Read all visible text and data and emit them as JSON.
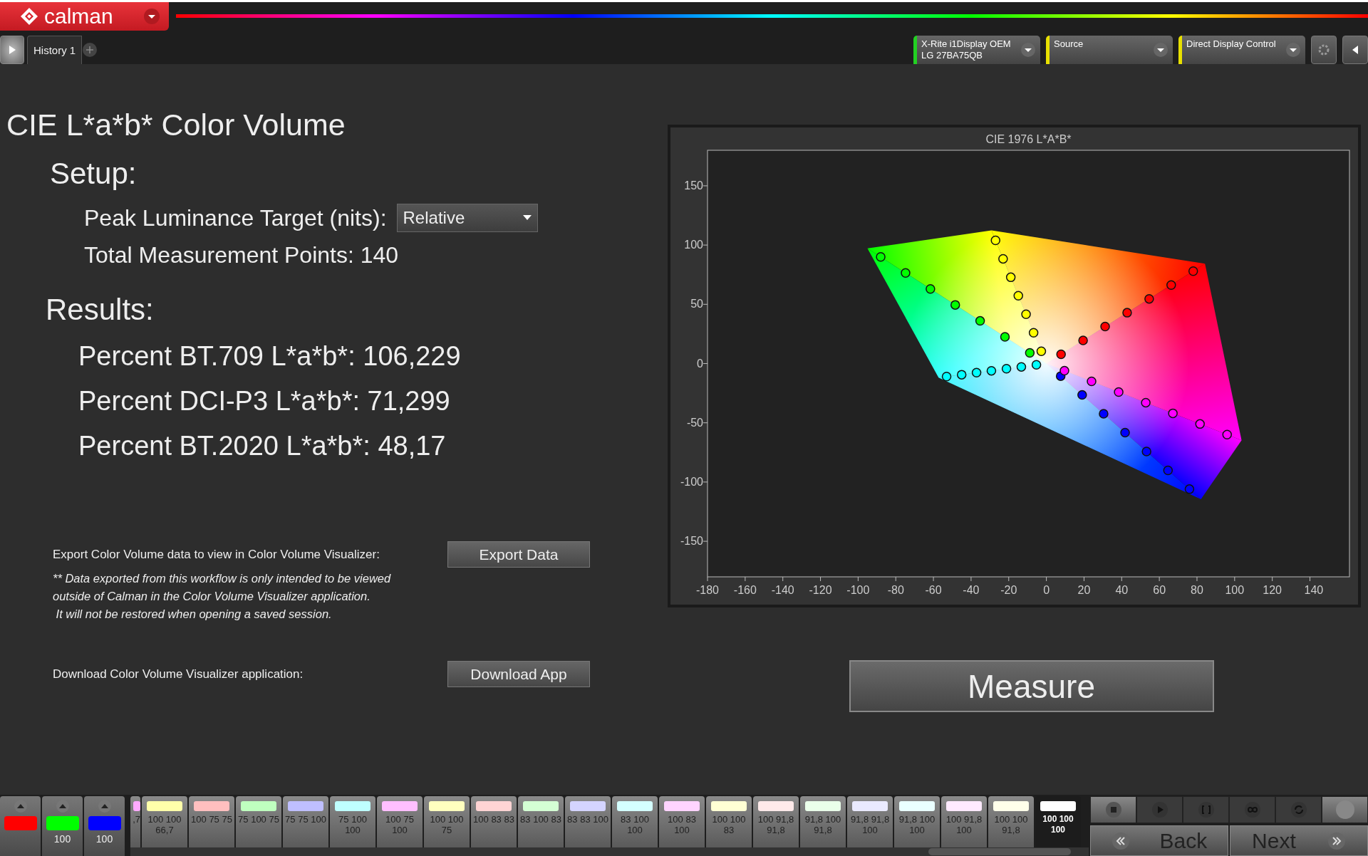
{
  "app": {
    "logo": "calman"
  },
  "tabs": [
    {
      "label": "History 1",
      "selected": true
    }
  ],
  "devices": [
    {
      "lines": [
        "X-Rite i1Display OEM",
        "LG 27BA75QB"
      ],
      "color": "#22d022"
    },
    {
      "lines": [
        "Source"
      ],
      "color": "#e8e000"
    },
    {
      "lines": [
        "Direct Display Control"
      ],
      "color": "#e8e000"
    }
  ],
  "page": {
    "title": "CIE L*a*b* Color Volume",
    "setup_heading": "Setup:",
    "peak_label": "Peak Luminance Target (nits):",
    "peak_value": "Relative",
    "total": "Total Measurement Points: 140",
    "results_heading": "Results:",
    "results": [
      "Percent BT.709 L*a*b*: 106,229",
      "Percent DCI-P3 L*a*b*: 71,299",
      "Percent BT.2020 L*a*b*: 48,17"
    ],
    "export_label": "Export Color Volume data to view in Color Volume Visualizer:",
    "export_button": "Export Data",
    "note_lines": [
      "** Data exported from this workflow is only intended to be viewed",
      "outside of Calman in the Color Volume Visualizer application.",
      " It will not be restored when opening a saved session."
    ],
    "download_label": "Download Color Volume Visualizer application:",
    "download_button": "Download App"
  },
  "chart": {
    "chart_data": {
      "type": "scatter",
      "title": "CIE 1976 L*A*B*",
      "xlim": [
        -180,
        161
      ],
      "ylim": [
        -180,
        180
      ],
      "xticks": [
        -180,
        -160,
        -140,
        -120,
        -100,
        -80,
        -60,
        -40,
        -20,
        0,
        20,
        40,
        60,
        80,
        100,
        120,
        140
      ],
      "yticks": [
        -150,
        -100,
        -50,
        0,
        50,
        100,
        150
      ],
      "series": [
        {
          "color": "#ff0000",
          "x": [
            7.8,
            19.5,
            31.2,
            42.9,
            54.6,
            66.3,
            78
          ],
          "values": [
            7.8,
            19.5,
            31.2,
            42.9,
            54.6,
            66.3,
            78
          ]
        },
        {
          "color": "#ffff00",
          "x": [
            -2.7,
            -6.8,
            -10.8,
            -14.9,
            -18.9,
            -23,
            -27
          ],
          "values": [
            10.4,
            26,
            41.6,
            57.2,
            72.8,
            88.4,
            104
          ]
        },
        {
          "color": "#00ff00",
          "x": [
            -8.8,
            -22,
            -35.2,
            -48.4,
            -61.6,
            -74.8,
            -88
          ],
          "values": [
            9,
            22.5,
            36,
            49.5,
            63,
            76.5,
            90
          ]
        },
        {
          "color": "#00ffff",
          "x": [
            -5.3,
            -13.3,
            -21.2,
            -29.2,
            -37.1,
            -45,
            -53
          ],
          "values": [
            -1.1,
            -2.8,
            -4.4,
            -6.1,
            -7.7,
            -9.4,
            -11
          ]
        },
        {
          "color": "#0000ff",
          "x": [
            7.6,
            19,
            30.4,
            41.8,
            53.2,
            64.6,
            76
          ],
          "values": [
            -10.6,
            -26.5,
            -42.4,
            -58.3,
            -74.2,
            -90.1,
            -106
          ]
        },
        {
          "color": "#ff00ff",
          "x": [
            9.6,
            24,
            38.4,
            52.8,
            67.2,
            81.6,
            96
          ],
          "values": [
            -6,
            -15,
            -24,
            -33,
            -42,
            -51,
            -60
          ]
        }
      ]
    }
  },
  "measure_button": "Measure",
  "channels": [
    {
      "color": "#ff0000"
    },
    {
      "color": "#00ff00",
      "label": "100"
    },
    {
      "color": "#0000ff",
      "label": "100"
    }
  ],
  "swatches": [
    {
      "color": "#ffaaff",
      "label": ",7",
      "selected": false
    },
    {
      "color": "#ffffaa",
      "label": "100 100 66,7",
      "selected": false
    },
    {
      "color": "#ffbfbf",
      "label": "100 75 75",
      "selected": false
    },
    {
      "color": "#bfffbf",
      "label": "75 100 75",
      "selected": false
    },
    {
      "color": "#bfbfff",
      "label": "75 75 100",
      "selected": false
    },
    {
      "color": "#bfffff",
      "label": "75 100 100",
      "selected": false
    },
    {
      "color": "#ffbfff",
      "label": "100 75 100",
      "selected": false
    },
    {
      "color": "#ffffbf",
      "label": "100 100 75",
      "selected": false
    },
    {
      "color": "#ffd4d4",
      "label": "100 83 83",
      "selected": false
    },
    {
      "color": "#d4ffd4",
      "label": "83 100 83",
      "selected": false
    },
    {
      "color": "#d4d4ff",
      "label": "83 83 100",
      "selected": false
    },
    {
      "color": "#d4ffff",
      "label": "83 100 100",
      "selected": false
    },
    {
      "color": "#ffd4ff",
      "label": "100 83 100",
      "selected": false
    },
    {
      "color": "#ffffd4",
      "label": "100 100 83",
      "selected": false
    },
    {
      "color": "#ffeaea",
      "label": "100 91,8 91,8",
      "selected": false
    },
    {
      "color": "#eaffea",
      "label": "91,8 100 91,8",
      "selected": false
    },
    {
      "color": "#eaeaff",
      "label": "91,8 91,8 100",
      "selected": false
    },
    {
      "color": "#eaffff",
      "label": "91,8 100 100",
      "selected": false
    },
    {
      "color": "#ffeaff",
      "label": "100 91,8 100",
      "selected": false
    },
    {
      "color": "#ffffea",
      "label": "100 100 91,8",
      "selected": false
    },
    {
      "color": "#ffffff",
      "label": "100 100 100",
      "selected": true
    }
  ],
  "controls": {
    "back": "Back",
    "next": "Next"
  }
}
